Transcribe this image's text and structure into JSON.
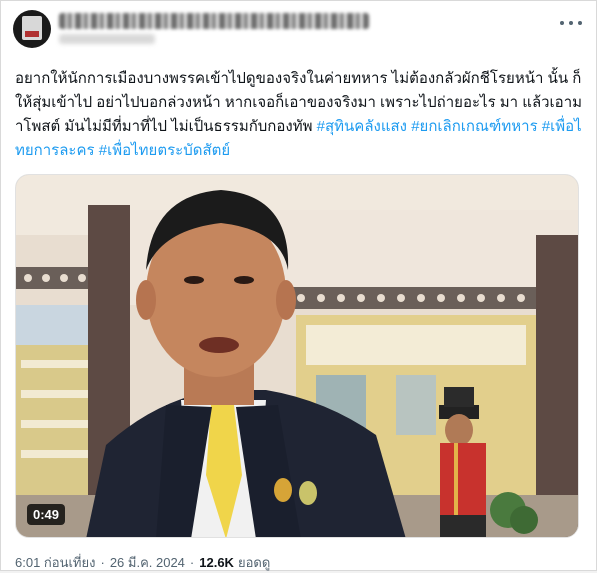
{
  "tweet": {
    "menu_icon": "more-horizontal-icon",
    "text_plain": "อยากให้นักการเมืองบางพรรคเข้าไปดูของจริงในค่ายทหาร ไม่ต้องกลัวผักชีโรยหน้า นั้น ก็ให้สุ่มเข้าไป อย่าไปบอกล่วงหน้า หากเจอก็เอาของจริงมา เพราะไปถ่ายอะไร มา แล้วเอามาโพสต์ มันไม่มีที่มาที่ไป ไม่เป็นธรรมกับกองทัพ",
    "hashtags": [
      "#สุทินคลังแสง",
      "#ยกเลิกเกณฑ์ทหาร",
      "#เพื่อไทยการละคร",
      "#เพื่อไทยตระบัดสัตย์"
    ],
    "video": {
      "duration": "0:49"
    },
    "time": "6:01 ก่อนเที่ยง",
    "date": "26 มี.ค. 2024",
    "separator": "·",
    "views_count": "12.6K",
    "views_label": "ยอดดู",
    "link_color": "#1d9bf0"
  }
}
